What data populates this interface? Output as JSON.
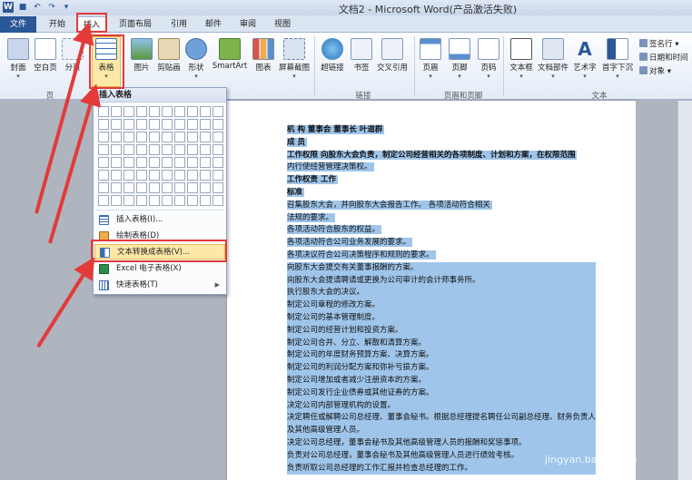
{
  "window": {
    "title": "文档2 - Microsoft Word(产品激活失败)"
  },
  "tabs": [
    "文件",
    "开始",
    "插入",
    "页面布局",
    "引用",
    "邮件",
    "审阅",
    "视图"
  ],
  "ribbon": {
    "buttons": [
      "封面",
      "空白页",
      "分页",
      "表格",
      "图片",
      "剪贴画",
      "形状",
      "SmartArt",
      "图表",
      "屏幕截图",
      "超链接",
      "书签",
      "交叉引用",
      "页眉",
      "页脚",
      "页码",
      "文本框",
      "文档部件",
      "艺术字",
      "首字下沉"
    ],
    "small": [
      "签名行",
      "日期和时间",
      "对象"
    ],
    "groups": [
      "页",
      "链接",
      "页眉和页脚",
      "文本"
    ]
  },
  "menu": {
    "title": "插入表格",
    "items": [
      "插入表格(I)...",
      "绘制表格(D)",
      "文本转换成表格(V)...",
      "Excel 电子表格(X)",
      "快速表格(T)"
    ]
  },
  "doc": {
    "lines": [
      "机    构    董事会                董事长                 叶道群",
      "成    员",
      "工作权限    向股东大会负责，制定公司经营相关的各项制度、计划和方案，在权限范围",
      "内行使经营管理决策权。",
      "工作权责                                                          工作",
      "标准",
      "召集股东大会，并向股东大会报告工作。      各项活动符合相关",
      "法规的要求。",
      "各项活动符合股东的权益。",
      "各项活动符合公司业务发展的要求。",
      "各项决议符合公司决策程序和规则的要求。",
      "向股东大会提交有关董事报酬的方案。",
      "向股东大会提请聘请或更换为公司审计的会计师事务所。",
      "执行股东大会的决议。",
      "制定公司章程的修改方案。",
      "制定公司的基本管理制度。",
      "制定公司的经营计划和投资方案。",
      "制定公司合并、分立、解散和清算方案。",
      "制定公司的年度财务预算方案、决算方案。",
      "制定公司的利润分配方案和弥补亏损方案。",
      "制定公司增加或者减少注册资本的方案。",
      "制定公司发行企业债券或其他证券的方案。",
      "决定公司内部管理机构的设置。",
      "决定聘任或解聘公司总经理、董事会秘书。根据总经理提名聘任公司副总经理、财务负责人",
      "及其他高级管理人员。",
      "决定公司总经理，董事会秘书及其他高级管理人员的报酬和奖惩事项。",
      "负责对公司总经理，董事会秘书及其他高级管理人员进行绩效考核。",
      "负责听取公司总经理的工作汇报并检查总经理的工作。"
    ]
  },
  "watermark": "jingyan.baidu.com"
}
